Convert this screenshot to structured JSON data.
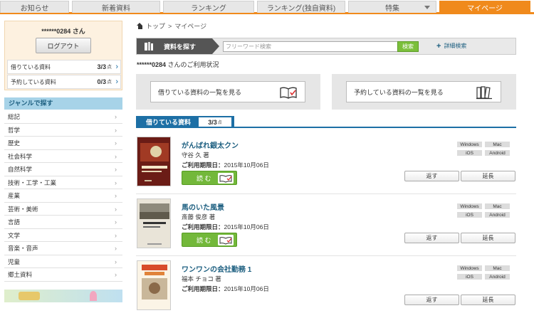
{
  "nav": {
    "tabs": [
      {
        "label": "お知らせ"
      },
      {
        "label": "新着資料"
      },
      {
        "label": "ランキング"
      },
      {
        "label": "ランキング(独自資料)"
      },
      {
        "label": "特集"
      },
      {
        "label": "マイページ"
      }
    ],
    "accent": "#f08a1c"
  },
  "user": {
    "name": "******0284 さん",
    "logout_label": "ログアウト",
    "borrowing_label": "借りている資料",
    "borrowing_count": "3/3",
    "reserved_label": "予約している資料",
    "reserved_count": "0/3",
    "unit": "点"
  },
  "genre": {
    "heading": "ジャンルで探す",
    "items": [
      "総記",
      "哲学",
      "歴史",
      "社会科学",
      "自然科学",
      "技術・工学・工業",
      "産業",
      "芸術・美術",
      "言語",
      "文学",
      "音楽・音声",
      "児童",
      "郷土資料"
    ]
  },
  "breadcrumb": {
    "home": "トップ",
    "sep": ">",
    "current": "マイページ"
  },
  "search": {
    "label": "資料を探す",
    "placeholder": "フリーワード検索",
    "button": "検索",
    "advanced": "詳細検索"
  },
  "main": {
    "status_user": "******0284",
    "status_suffix": " さんのご利用状況",
    "borrow_list_button": "借りている資料の一覧を見る",
    "reserve_list_button": "予約している資料の一覧を見る",
    "borrowing_tab": "借りている資料",
    "borrowing_count": "3/3",
    "borrowing_unit": "点"
  },
  "books": [
    {
      "title": "がんばれ銀太クン",
      "author": "守谷 久 著",
      "due_label": "ご利用期限日：",
      "due": "2015年10月06日"
    },
    {
      "title": "馬のいた風景",
      "author": "斎藤 俊彦 著",
      "due_label": "ご利用期限日：",
      "due": "2015年10月06日"
    },
    {
      "title": "ワンワンの会社勤務 1",
      "author": "福本 チョコ 著",
      "due_label": "ご利用期限日：",
      "due": "2015年10月06日"
    }
  ],
  "book_ui": {
    "read_label": "読 む",
    "return_label": "返す",
    "extend_label": "延長",
    "platforms": [
      "Windows",
      "Mac",
      "iOS",
      "Android"
    ]
  }
}
